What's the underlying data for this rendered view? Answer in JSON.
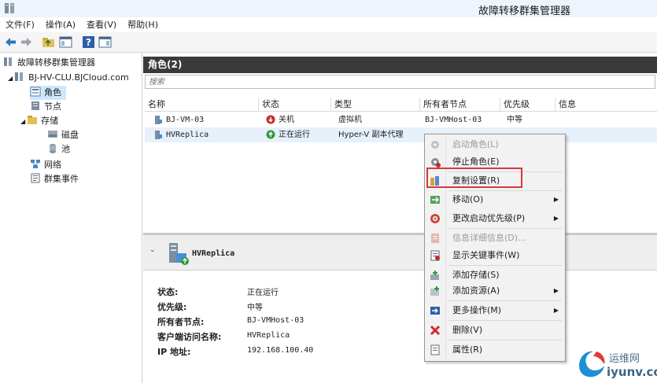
{
  "window": {
    "title": "故障转移群集管理器"
  },
  "menubar": {
    "items": [
      "文件(F)",
      "操作(A)",
      "查看(V)",
      "帮助(H)"
    ]
  },
  "tree": {
    "root": "故障转移群集管理器",
    "cluster": "BJ-HV-CLU.BJCloud.com",
    "items": [
      "角色",
      "节点",
      "存储",
      "磁盘",
      "池",
      "网络",
      "群集事件"
    ]
  },
  "roles": {
    "header": "角色(2)",
    "search_placeholder": "搜索",
    "columns": [
      "名称",
      "状态",
      "类型",
      "所有者节点",
      "优先级",
      "信息"
    ],
    "rows": [
      {
        "name": "BJ-VM-03",
        "status": "关机",
        "type": "虚拟机",
        "owner": "BJ-VMHost-03",
        "priority": "中等",
        "info": ""
      },
      {
        "name": "HVReplica",
        "status": "正在运行",
        "type": "Hyper-V 副本代理",
        "owner": "",
        "priority": "",
        "info": ""
      }
    ]
  },
  "detail": {
    "title": "HVReplica",
    "fields": [
      {
        "label": "状态:",
        "value": "正在运行"
      },
      {
        "label": "优先级:",
        "value": "中等"
      },
      {
        "label": "所有者节点:",
        "value": "BJ-VMHost-03"
      },
      {
        "label": "客户端访问名称:",
        "value": "HVReplica"
      },
      {
        "label": "IP 地址:",
        "value": "192.168.100.40"
      }
    ]
  },
  "context_menu": {
    "items": [
      {
        "label": "启动角色(L)",
        "disabled": true,
        "submenu": false,
        "icon": "start-role-icon"
      },
      {
        "label": "停止角色(E)",
        "disabled": false,
        "submenu": false,
        "icon": "stop-role-icon"
      },
      {
        "label": "复制设置(R)",
        "disabled": false,
        "submenu": false,
        "icon": "replication-settings-icon"
      },
      {
        "label": "移动(O)",
        "disabled": false,
        "submenu": true,
        "icon": "move-icon"
      },
      {
        "label": "更改启动优先级(P)",
        "disabled": false,
        "submenu": true,
        "icon": "priority-icon"
      },
      {
        "label": "信息详细信息(D)...",
        "disabled": true,
        "submenu": false,
        "icon": "info-details-icon"
      },
      {
        "label": "显示关键事件(W)",
        "disabled": false,
        "submenu": false,
        "icon": "critical-events-icon"
      },
      {
        "label": "添加存储(S)",
        "disabled": false,
        "submenu": false,
        "icon": "add-storage-icon"
      },
      {
        "label": "添加资源(A)",
        "disabled": false,
        "submenu": true,
        "icon": "add-resource-icon"
      },
      {
        "label": "更多操作(M)",
        "disabled": false,
        "submenu": true,
        "icon": "more-actions-icon"
      },
      {
        "label": "删除(V)",
        "disabled": false,
        "submenu": false,
        "icon": "delete-icon"
      },
      {
        "label": "属性(R)",
        "disabled": false,
        "submenu": false,
        "icon": "properties-icon"
      }
    ]
  },
  "watermark": {
    "line1": "运维网",
    "line2": "iyunv.com"
  },
  "colors": {
    "highlight": "#d9363e",
    "header_bg": "#3a3a3a",
    "selection": "#cce8ff"
  }
}
